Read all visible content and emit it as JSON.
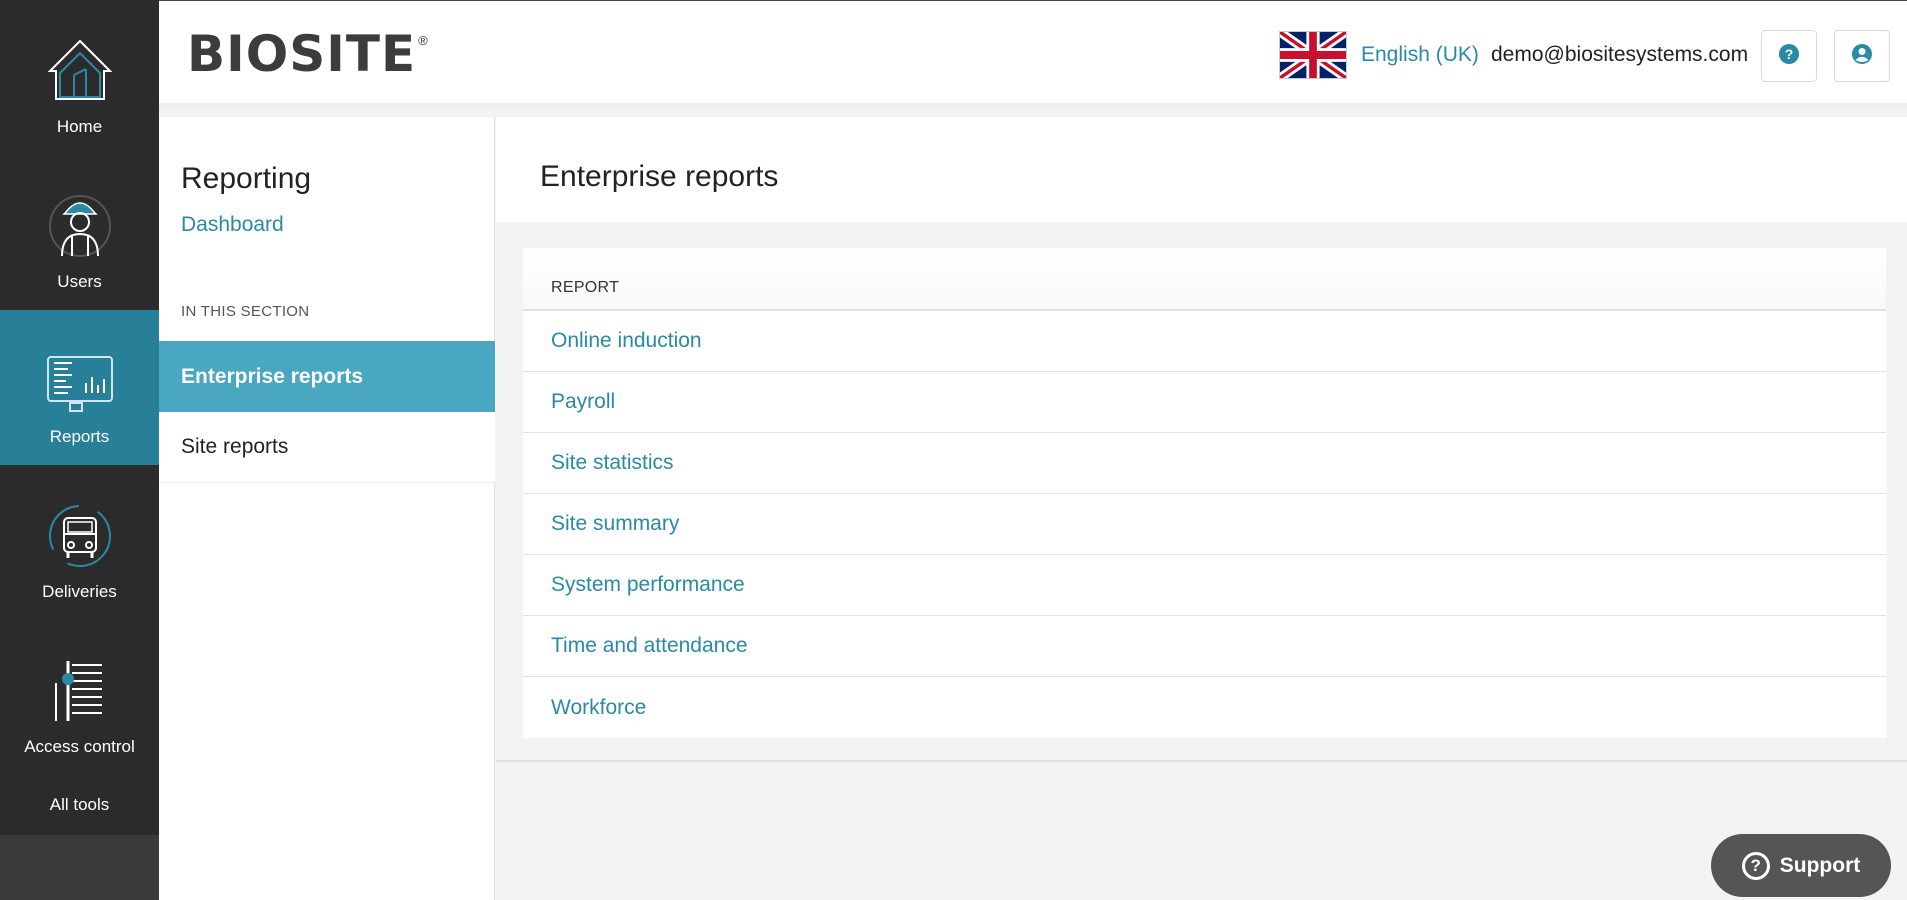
{
  "brand": {
    "logo_text": "BIOSITE",
    "registered": "®"
  },
  "leftnav": {
    "items": [
      {
        "label": "Home",
        "icon": "house-icon"
      },
      {
        "label": "Users",
        "icon": "worker-icon"
      },
      {
        "label": "Reports",
        "icon": "reports-icon"
      },
      {
        "label": "Deliveries",
        "icon": "truck-icon"
      },
      {
        "label": "Access control",
        "icon": "turnstile-icon"
      }
    ],
    "all_tools": "All tools"
  },
  "header": {
    "language": "English (UK)",
    "language_flag": "uk-flag-icon",
    "user_email": "demo@biositesystems.com",
    "help_icon": "question-circle-icon",
    "account_icon": "user-circle-icon"
  },
  "subnav": {
    "title": "Reporting",
    "dashboard_link": "Dashboard",
    "section_heading": "IN THIS SECTION",
    "items": [
      {
        "label": "Enterprise reports",
        "active": true
      },
      {
        "label": "Site reports",
        "active": false
      }
    ]
  },
  "main": {
    "title": "Enterprise reports",
    "table": {
      "header": "REPORT",
      "rows": [
        "Online induction",
        "Payroll",
        "Site statistics",
        "Site summary",
        "System performance",
        "Time and attendance",
        "Workforce"
      ]
    }
  },
  "support": {
    "label": "Support"
  },
  "colors": {
    "accent": "#2a8aa5",
    "active_nav": "#287f98",
    "active_subnav": "#4aa7c1",
    "sidebar_bg": "#2b2b2b"
  }
}
